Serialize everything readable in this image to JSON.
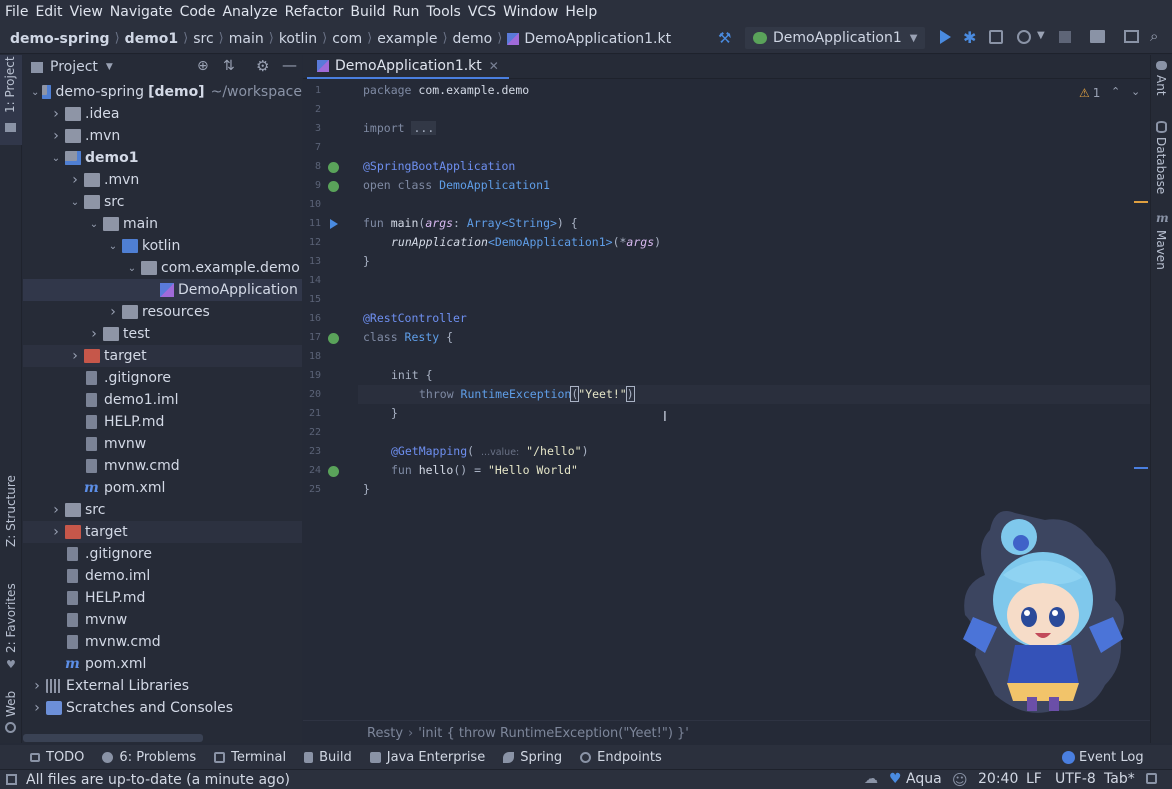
{
  "menu": [
    "File",
    "Edit",
    "View",
    "Navigate",
    "Code",
    "Analyze",
    "Refactor",
    "Build",
    "Run",
    "Tools",
    "VCS",
    "Window",
    "Help"
  ],
  "breadcrumb": [
    "demo-spring",
    "demo1",
    "src",
    "main",
    "kotlin",
    "com",
    "example",
    "demo",
    "DemoApplication1.kt"
  ],
  "run_config": "DemoApplication1",
  "left_tools": [
    "1: Project",
    "Z: Structure",
    "2: Favorites",
    "Web"
  ],
  "right_tools": [
    "Ant",
    "Database",
    "Maven"
  ],
  "project_panel": {
    "title": "Project",
    "tree": [
      {
        "label": "demo-spring",
        "suffix": "[demo]",
        "path": "~/workspace",
        "level": 0,
        "icon": "module-folder",
        "open": true
      },
      {
        "label": ".idea",
        "level": 1,
        "icon": "folder",
        "open": false
      },
      {
        "label": ".mvn",
        "level": 1,
        "icon": "folder",
        "open": false
      },
      {
        "label": "demo1",
        "level": 1,
        "icon": "module-folder",
        "open": true
      },
      {
        "label": ".mvn",
        "level": 2,
        "icon": "folder",
        "open": false
      },
      {
        "label": "src",
        "level": 2,
        "icon": "folder",
        "open": true
      },
      {
        "label": "main",
        "level": 3,
        "icon": "folder",
        "open": true
      },
      {
        "label": "kotlin",
        "level": 4,
        "icon": "blue-folder",
        "open": true
      },
      {
        "label": "com.example.demo",
        "level": 5,
        "icon": "package-folder",
        "open": true
      },
      {
        "label": "DemoApplication",
        "level": 6,
        "icon": "kotlin-file",
        "selected": true
      },
      {
        "label": "resources",
        "level": 4,
        "icon": "resources-folder",
        "open": false
      },
      {
        "label": "test",
        "level": 3,
        "icon": "folder",
        "open": false
      },
      {
        "label": "target",
        "level": 2,
        "icon": "orange-folder",
        "open": false,
        "highlight": true
      },
      {
        "label": ".gitignore",
        "level": 2,
        "icon": "file"
      },
      {
        "label": "demo1.iml",
        "level": 2,
        "icon": "file"
      },
      {
        "label": "HELP.md",
        "level": 2,
        "icon": "file"
      },
      {
        "label": "mvnw",
        "level": 2,
        "icon": "file"
      },
      {
        "label": "mvnw.cmd",
        "level": 2,
        "icon": "file"
      },
      {
        "label": "pom.xml",
        "level": 2,
        "icon": "maven-file"
      },
      {
        "label": "src",
        "level": 1,
        "icon": "folder",
        "open": false
      },
      {
        "label": "target",
        "level": 1,
        "icon": "orange-folder",
        "open": false,
        "highlight": true
      },
      {
        "label": ".gitignore",
        "level": 1,
        "icon": "file"
      },
      {
        "label": "demo.iml",
        "level": 1,
        "icon": "file"
      },
      {
        "label": "HELP.md",
        "level": 1,
        "icon": "file"
      },
      {
        "label": "mvnw",
        "level": 1,
        "icon": "file"
      },
      {
        "label": "mvnw.cmd",
        "level": 1,
        "icon": "file"
      },
      {
        "label": "pom.xml",
        "level": 1,
        "icon": "maven-file"
      },
      {
        "label": "External Libraries",
        "level": 0,
        "icon": "library",
        "open": false
      },
      {
        "label": "Scratches and Consoles",
        "level": 0,
        "icon": "scratch",
        "open": false
      }
    ]
  },
  "editor": {
    "tab": "DemoApplication1.kt",
    "warning_count": "1",
    "line_numbers": [
      "1",
      "2",
      "3",
      "7",
      "8",
      "9",
      "10",
      "11",
      "12",
      "13",
      "14",
      "15",
      "16",
      "17",
      "18",
      "19",
      "20",
      "21",
      "22",
      "23",
      "24",
      "25"
    ],
    "code": {
      "l1_kw": "package",
      "l1_pkg": " com.example.demo",
      "l3_kw": "import",
      "l3_fold": "...",
      "l8": "@SpringBootApplication",
      "l9_kw": "open class ",
      "l9_cls": "DemoApplication1",
      "l11_kw": "fun ",
      "l11_fn": "main",
      "l11_p1": "(",
      "l11_arg": "args",
      "l11_p2": ": ",
      "l11_type": "Array<String>",
      "l11_p3": ") {",
      "l12_fn": "runApplication",
      "l12_gen": "<DemoApplication1>",
      "l12_p": "(*",
      "l12_arg": "args",
      "l12_end": ")",
      "l13": "}",
      "l16": "@RestController",
      "l17_kw": "class ",
      "l17_cls": "Resty",
      "l17_end": " {",
      "l19": "init {",
      "l20_kw": "throw ",
      "l20_cls": "RuntimeException",
      "l20_p": "(",
      "l20_str": "\"Yeet!\"",
      "l20_end": ")",
      "l21": "}",
      "l23_ann": "@GetMapping",
      "l23_p": "( ",
      "l23_hint": "...value:",
      "l23_str": " \"/hello\"",
      "l23_end": ")",
      "l24_kw": "fun ",
      "l24_fn": "hello",
      "l24_mid": "() = ",
      "l24_str": "\"Hello World\"",
      "l25": "}"
    },
    "context_bar": [
      "Resty",
      "'init { throw RuntimeException(\"Yeet!\") }'"
    ]
  },
  "bottom_tools": [
    "TODO",
    "6: Problems",
    "Terminal",
    "Build",
    "Java Enterprise",
    "Spring",
    "Endpoints"
  ],
  "event_log": "Event Log",
  "status": {
    "message": "All files are up-to-date (a minute ago)",
    "theme": "Aqua",
    "time": "20:40",
    "line_sep": "LF",
    "encoding": "UTF-8",
    "indent": "Tab*"
  },
  "colors": {
    "accent": "#4a7fe0",
    "background": "#252a37",
    "selection": "#31374a"
  }
}
